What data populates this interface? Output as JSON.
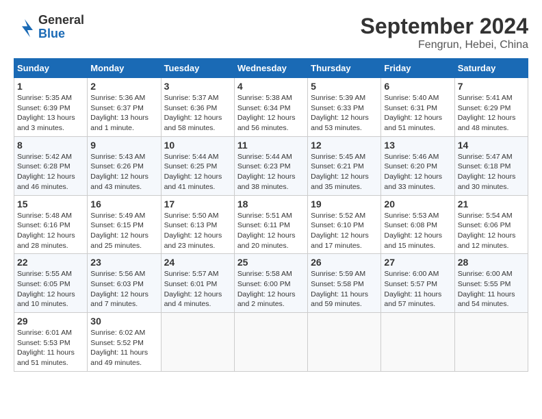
{
  "header": {
    "logo_general": "General",
    "logo_blue": "Blue",
    "month": "September 2024",
    "location": "Fengrun, Hebei, China"
  },
  "weekdays": [
    "Sunday",
    "Monday",
    "Tuesday",
    "Wednesday",
    "Thursday",
    "Friday",
    "Saturday"
  ],
  "weeks": [
    [
      {
        "day": "1",
        "info": "Sunrise: 5:35 AM\nSunset: 6:39 PM\nDaylight: 13 hours\nand 3 minutes."
      },
      {
        "day": "2",
        "info": "Sunrise: 5:36 AM\nSunset: 6:37 PM\nDaylight: 13 hours\nand 1 minute."
      },
      {
        "day": "3",
        "info": "Sunrise: 5:37 AM\nSunset: 6:36 PM\nDaylight: 12 hours\nand 58 minutes."
      },
      {
        "day": "4",
        "info": "Sunrise: 5:38 AM\nSunset: 6:34 PM\nDaylight: 12 hours\nand 56 minutes."
      },
      {
        "day": "5",
        "info": "Sunrise: 5:39 AM\nSunset: 6:33 PM\nDaylight: 12 hours\nand 53 minutes."
      },
      {
        "day": "6",
        "info": "Sunrise: 5:40 AM\nSunset: 6:31 PM\nDaylight: 12 hours\nand 51 minutes."
      },
      {
        "day": "7",
        "info": "Sunrise: 5:41 AM\nSunset: 6:29 PM\nDaylight: 12 hours\nand 48 minutes."
      }
    ],
    [
      {
        "day": "8",
        "info": "Sunrise: 5:42 AM\nSunset: 6:28 PM\nDaylight: 12 hours\nand 46 minutes."
      },
      {
        "day": "9",
        "info": "Sunrise: 5:43 AM\nSunset: 6:26 PM\nDaylight: 12 hours\nand 43 minutes."
      },
      {
        "day": "10",
        "info": "Sunrise: 5:44 AM\nSunset: 6:25 PM\nDaylight: 12 hours\nand 41 minutes."
      },
      {
        "day": "11",
        "info": "Sunrise: 5:44 AM\nSunset: 6:23 PM\nDaylight: 12 hours\nand 38 minutes."
      },
      {
        "day": "12",
        "info": "Sunrise: 5:45 AM\nSunset: 6:21 PM\nDaylight: 12 hours\nand 35 minutes."
      },
      {
        "day": "13",
        "info": "Sunrise: 5:46 AM\nSunset: 6:20 PM\nDaylight: 12 hours\nand 33 minutes."
      },
      {
        "day": "14",
        "info": "Sunrise: 5:47 AM\nSunset: 6:18 PM\nDaylight: 12 hours\nand 30 minutes."
      }
    ],
    [
      {
        "day": "15",
        "info": "Sunrise: 5:48 AM\nSunset: 6:16 PM\nDaylight: 12 hours\nand 28 minutes."
      },
      {
        "day": "16",
        "info": "Sunrise: 5:49 AM\nSunset: 6:15 PM\nDaylight: 12 hours\nand 25 minutes."
      },
      {
        "day": "17",
        "info": "Sunrise: 5:50 AM\nSunset: 6:13 PM\nDaylight: 12 hours\nand 23 minutes."
      },
      {
        "day": "18",
        "info": "Sunrise: 5:51 AM\nSunset: 6:11 PM\nDaylight: 12 hours\nand 20 minutes."
      },
      {
        "day": "19",
        "info": "Sunrise: 5:52 AM\nSunset: 6:10 PM\nDaylight: 12 hours\nand 17 minutes."
      },
      {
        "day": "20",
        "info": "Sunrise: 5:53 AM\nSunset: 6:08 PM\nDaylight: 12 hours\nand 15 minutes."
      },
      {
        "day": "21",
        "info": "Sunrise: 5:54 AM\nSunset: 6:06 PM\nDaylight: 12 hours\nand 12 minutes."
      }
    ],
    [
      {
        "day": "22",
        "info": "Sunrise: 5:55 AM\nSunset: 6:05 PM\nDaylight: 12 hours\nand 10 minutes."
      },
      {
        "day": "23",
        "info": "Sunrise: 5:56 AM\nSunset: 6:03 PM\nDaylight: 12 hours\nand 7 minutes."
      },
      {
        "day": "24",
        "info": "Sunrise: 5:57 AM\nSunset: 6:01 PM\nDaylight: 12 hours\nand 4 minutes."
      },
      {
        "day": "25",
        "info": "Sunrise: 5:58 AM\nSunset: 6:00 PM\nDaylight: 12 hours\nand 2 minutes."
      },
      {
        "day": "26",
        "info": "Sunrise: 5:59 AM\nSunset: 5:58 PM\nDaylight: 11 hours\nand 59 minutes."
      },
      {
        "day": "27",
        "info": "Sunrise: 6:00 AM\nSunset: 5:57 PM\nDaylight: 11 hours\nand 57 minutes."
      },
      {
        "day": "28",
        "info": "Sunrise: 6:00 AM\nSunset: 5:55 PM\nDaylight: 11 hours\nand 54 minutes."
      }
    ],
    [
      {
        "day": "29",
        "info": "Sunrise: 6:01 AM\nSunset: 5:53 PM\nDaylight: 11 hours\nand 51 minutes."
      },
      {
        "day": "30",
        "info": "Sunrise: 6:02 AM\nSunset: 5:52 PM\nDaylight: 11 hours\nand 49 minutes."
      },
      {
        "day": "",
        "info": ""
      },
      {
        "day": "",
        "info": ""
      },
      {
        "day": "",
        "info": ""
      },
      {
        "day": "",
        "info": ""
      },
      {
        "day": "",
        "info": ""
      }
    ]
  ]
}
